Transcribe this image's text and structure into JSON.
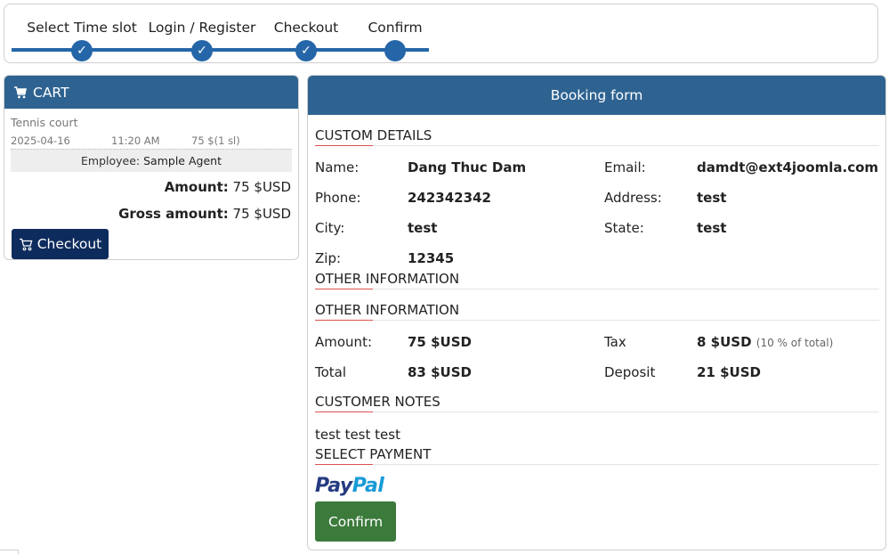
{
  "steps": [
    {
      "label": "Select Time slot",
      "mark": "✓",
      "state": "done"
    },
    {
      "label": "Login / Register",
      "mark": "✓",
      "state": "done"
    },
    {
      "label": "Checkout",
      "mark": "✓",
      "state": "done"
    },
    {
      "label": "Confirm",
      "mark": "",
      "state": "current"
    }
  ],
  "cart": {
    "title": "CART",
    "item_name": "Tennis court",
    "date": "2025-04-16",
    "time": "11:20 AM",
    "price": "75 $(1 sl)",
    "employee_label": "Employee:",
    "employee_name": "Sample Agent",
    "amount_label": "Amount:",
    "amount_value": "75 $USD",
    "gross_label": "Gross amount:",
    "gross_value": "75 $USD",
    "checkout_label": "Checkout"
  },
  "booking": {
    "title": "Booking form",
    "custom_details_title": "CUSTOM DETAILS",
    "name_label": "Name:",
    "name_value": "Dang Thuc Dam",
    "email_label": "Email:",
    "email_value": "damdt@ext4joomla.com",
    "phone_label": "Phone:",
    "phone_value": "242342342",
    "address_label": "Address:",
    "address_value": "test",
    "city_label": "City:",
    "city_value": "test",
    "state_label": "State:",
    "state_value": "test",
    "zip_label": "Zip:",
    "zip_value": "12345",
    "other_info_title_1": "OTHER INFORMATION",
    "other_info_title_2": "OTHER INFORMATION",
    "amount_label": "Amount:",
    "amount_value": "75 $USD",
    "tax_label": "Tax",
    "tax_value": "8 $USD",
    "tax_note": "(10 % of total)",
    "total_label": "Total",
    "total_value": "83 $USD",
    "deposit_label": "Deposit",
    "deposit_value": "21 $USD",
    "notes_title": "CUSTOMER NOTES",
    "notes_text": "test test test",
    "payment_title": "SELECT PAYMENT",
    "paypal_part1": "Pay",
    "paypal_part2": "Pal",
    "confirm_label": "Confirm"
  },
  "colors": {
    "header_blue": "#2e6391",
    "step_blue": "#2566a8",
    "checkout_navy": "#0e2b5d",
    "confirm_green": "#3b7a3b",
    "underline_red": "#d9534f"
  },
  "icons": {
    "cart": "shopping-cart-icon",
    "step_check": "checkmark-icon"
  }
}
